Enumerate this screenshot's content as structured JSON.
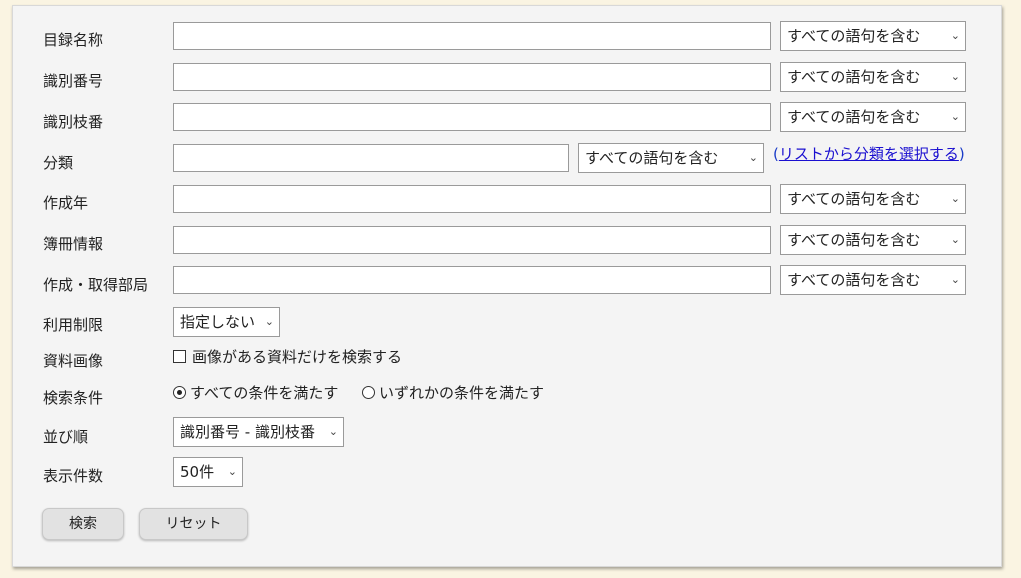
{
  "form": {
    "fields": [
      {
        "label": "目録名称",
        "value": "",
        "match": "すべての語句を含む"
      },
      {
        "label": "識別番号",
        "value": "",
        "match": "すべての語句を含む"
      },
      {
        "label": "識別枝番",
        "value": "",
        "match": "すべての語句を含む"
      },
      {
        "label": "分類",
        "value": "",
        "match": "すべての語句を含む"
      },
      {
        "label": "作成年",
        "value": "",
        "match": "すべての語句を含む"
      },
      {
        "label": "簿冊情報",
        "value": "",
        "match": "すべての語句を含む"
      },
      {
        "label": "作成・取得部局",
        "value": "",
        "match": "すべての語句を含む"
      }
    ],
    "category_link": {
      "open": "(",
      "text": "リストから分類を選択する",
      "close": ")"
    },
    "usage_limit": {
      "label": "利用制限",
      "selected": "指定しない"
    },
    "image": {
      "label": "資料画像",
      "checkbox_label": "画像がある資料だけを検索する",
      "checked": false
    },
    "condition": {
      "label": "検索条件",
      "options": [
        "すべての条件を満たす",
        "いずれかの条件を満たす"
      ],
      "selected_index": 0
    },
    "sort": {
      "label": "並び順",
      "selected": "識別番号 - 識別枝番"
    },
    "per_page": {
      "label": "表示件数",
      "selected": "50件"
    },
    "buttons": {
      "search": "検索",
      "reset": "リセット"
    },
    "chevron": "⌄"
  }
}
